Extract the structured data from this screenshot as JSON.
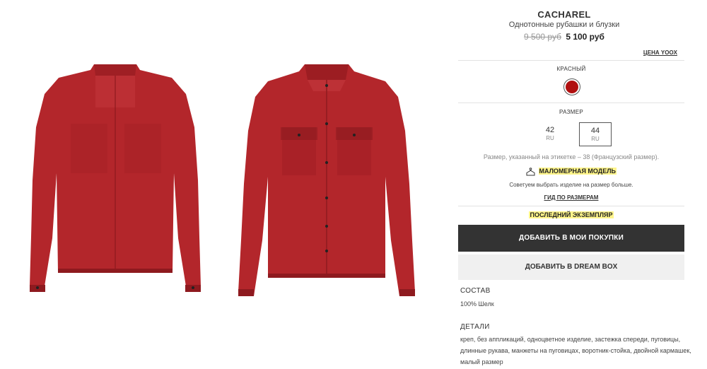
{
  "product": {
    "brand": "CACHAREL",
    "category": "Однотонные рубашки и блузки",
    "old_price": "9 500 руб",
    "new_price": "5 100 руб",
    "yoox_price_link": "ЦЕНА YOOX"
  },
  "color": {
    "label": "КРАСНЫЙ",
    "swatch_hex": "#b00f0f"
  },
  "size": {
    "label": "РАЗМЕР",
    "options": [
      {
        "value": "42",
        "region": "RU",
        "selected": false
      },
      {
        "value": "44",
        "region": "RU",
        "selected": true
      }
    ],
    "label_note": "Размер, указанный на этикетке – 38 (Французский размер).",
    "fit_label": "МАЛОМЕРНАЯ МОДЕЛЬ",
    "fit_advice": "Советуем выбрать изделие на размер больше.",
    "size_guide_link": "ГИД ПО РАЗМЕРАМ"
  },
  "stock_notice": "ПОСЛЕДНИЙ ЭКЗЕМПЛЯР",
  "buttons": {
    "add_to_cart": "ДОБАВИТЬ В МОИ ПОКУПКИ",
    "add_to_dreambox": "ДОБАВИТЬ В DREAM BOX"
  },
  "composition": {
    "title": "СОСТАВ",
    "text": "100% Шелк"
  },
  "details": {
    "title": "ДЕТАЛИ",
    "lines": [
      "креп, без аппликаций, одноцветное изделие, застежка спереди, пуговицы,",
      "длинные рукава, манжеты на пуговицах, воротник-стойка, двойной кармашек,",
      "малый размер"
    ]
  },
  "colors": {
    "shirt_red": "#b3262b",
    "shirt_dark": "#8e1a1f",
    "highlight": "#fff58a",
    "button_dark": "#333333"
  }
}
